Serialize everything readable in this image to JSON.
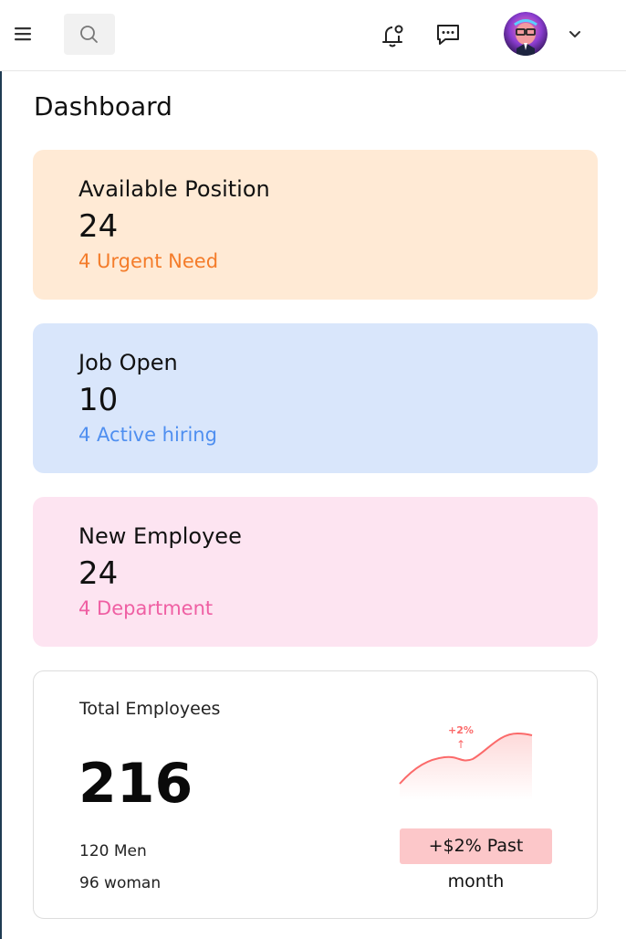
{
  "header": {
    "menu_icon": "hamburger-menu-icon",
    "search_icon": "search-icon",
    "notification_icon": "bell-icon",
    "messages_icon": "chat-icon",
    "profile_icon": "chevron-down-icon"
  },
  "page": {
    "title": "Dashboard"
  },
  "cards": [
    {
      "title": "Available Position",
      "value": "24",
      "subtitle": "4 Urgent Need",
      "bg": "#ffead5",
      "accent": "#f47c2a"
    },
    {
      "title": "Job Open",
      "value": "10",
      "subtitle": "4 Active hiring",
      "bg": "#d9e6fb",
      "accent": "#4f8ff0"
    },
    {
      "title": "New Employee",
      "value": "24",
      "subtitle": "4 Department",
      "bg": "#fde4f1",
      "accent": "#ef5fa3"
    }
  ],
  "total": {
    "label": "Total Employees",
    "value": "216",
    "men": "120 Men",
    "women": "96 woman",
    "trend_label": "+2%",
    "trend_arrow": "↑",
    "badge": "+$2% Past month",
    "trend_color": "#fb6a6a",
    "badge_color": "#fcc7c9"
  }
}
